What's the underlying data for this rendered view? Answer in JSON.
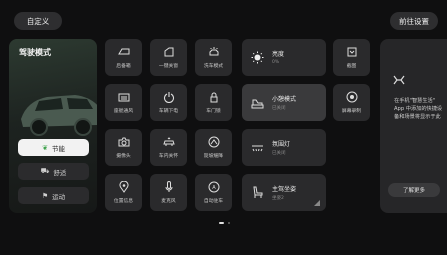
{
  "header": {
    "custom_label": "自定义",
    "settings_label": "前往设置"
  },
  "drive_mode": {
    "title": "驾驶模式",
    "modes": [
      {
        "label": "节能",
        "icon": "leaf-icon",
        "active": true
      },
      {
        "label": "舒适",
        "icon": "car-icon",
        "active": false
      },
      {
        "label": "运动",
        "icon": "sport-icon",
        "active": false
      }
    ]
  },
  "tiles": [
    {
      "label": "后备箱",
      "icon": "trunk-icon"
    },
    {
      "label": "一键关窗",
      "icon": "window-icon"
    },
    {
      "label": "洗车模式",
      "icon": "car-wash-icon"
    },
    {
      "label": "截图",
      "icon": "screenshot-icon"
    },
    {
      "label": "座舱通风",
      "icon": "ventilation-icon"
    },
    {
      "label": "车辆下电",
      "icon": "power-icon"
    },
    {
      "label": "车门锁",
      "icon": "lock-icon"
    },
    {
      "label": "屏幕录制",
      "icon": "record-icon"
    },
    {
      "label": "摄像头",
      "icon": "camera-icon"
    },
    {
      "label": "车内关怀",
      "icon": "care-icon"
    },
    {
      "label": "陡坡缓降",
      "icon": "hill-descent-icon"
    },
    {
      "label": "位置信息",
      "icon": "location-icon"
    },
    {
      "label": "麦克风",
      "icon": "microphone-icon"
    },
    {
      "label": "自动驻车",
      "icon": "auto-hold-icon"
    }
  ],
  "wide_tiles": {
    "brightness": {
      "title": "亮度",
      "sub": "0%"
    },
    "nap": {
      "title": "小憩模式",
      "sub": "已关闭"
    },
    "ambient": {
      "title": "氛围灯",
      "sub": "已关闭"
    },
    "seat": {
      "title": "主驾坐姿",
      "sub": "坐姿2"
    }
  },
  "right_panel": {
    "line1": "在手机\"智慧生活\"",
    "line2": "App 中添加的快捷设",
    "line3": "备和场景将显示于此",
    "more_label": "了解更多"
  },
  "colors": {
    "background": "#0f0f10",
    "tile": "#2a2a2c",
    "accent": "#3fa34d"
  }
}
